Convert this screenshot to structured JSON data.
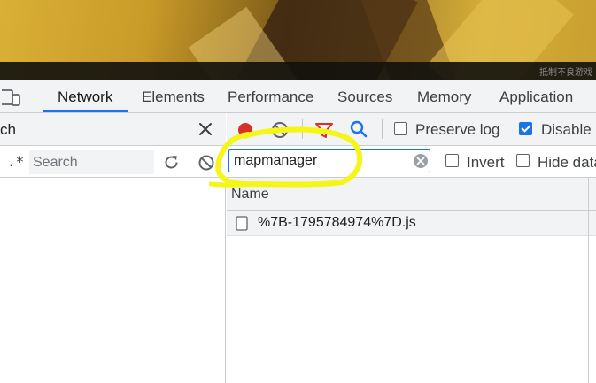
{
  "page_background": {
    "watermark": "抵制不良游戏"
  },
  "devtools": {
    "tabs": [
      {
        "label": "Network",
        "active": true
      },
      {
        "label": "Elements",
        "active": false
      },
      {
        "label": "Performance",
        "active": false
      },
      {
        "label": "Sources",
        "active": false
      },
      {
        "label": "Memory",
        "active": false
      },
      {
        "label": "Application",
        "active": false
      }
    ],
    "accent_color": "#1a73e8",
    "record_color": "#d93025"
  },
  "search_panel": {
    "title": "ch",
    "regex_label": ".*",
    "input_value": "",
    "input_placeholder": "Search"
  },
  "network_toolbar": {
    "preserve_log_label": "Preserve log",
    "preserve_log_checked": false,
    "disable_cache_label": "Disable c",
    "disable_cache_checked": true
  },
  "filter_row": {
    "filter_value": "mapmanager",
    "invert_label": "Invert",
    "invert_checked": false,
    "hide_data_label": "Hide data",
    "hide_data_checked": false
  },
  "requests_table": {
    "columns": [
      "Name"
    ],
    "rows": [
      {
        "name": "%7B-1795784974%7D.js"
      }
    ]
  },
  "annotation": {
    "color": "#f5f518"
  }
}
